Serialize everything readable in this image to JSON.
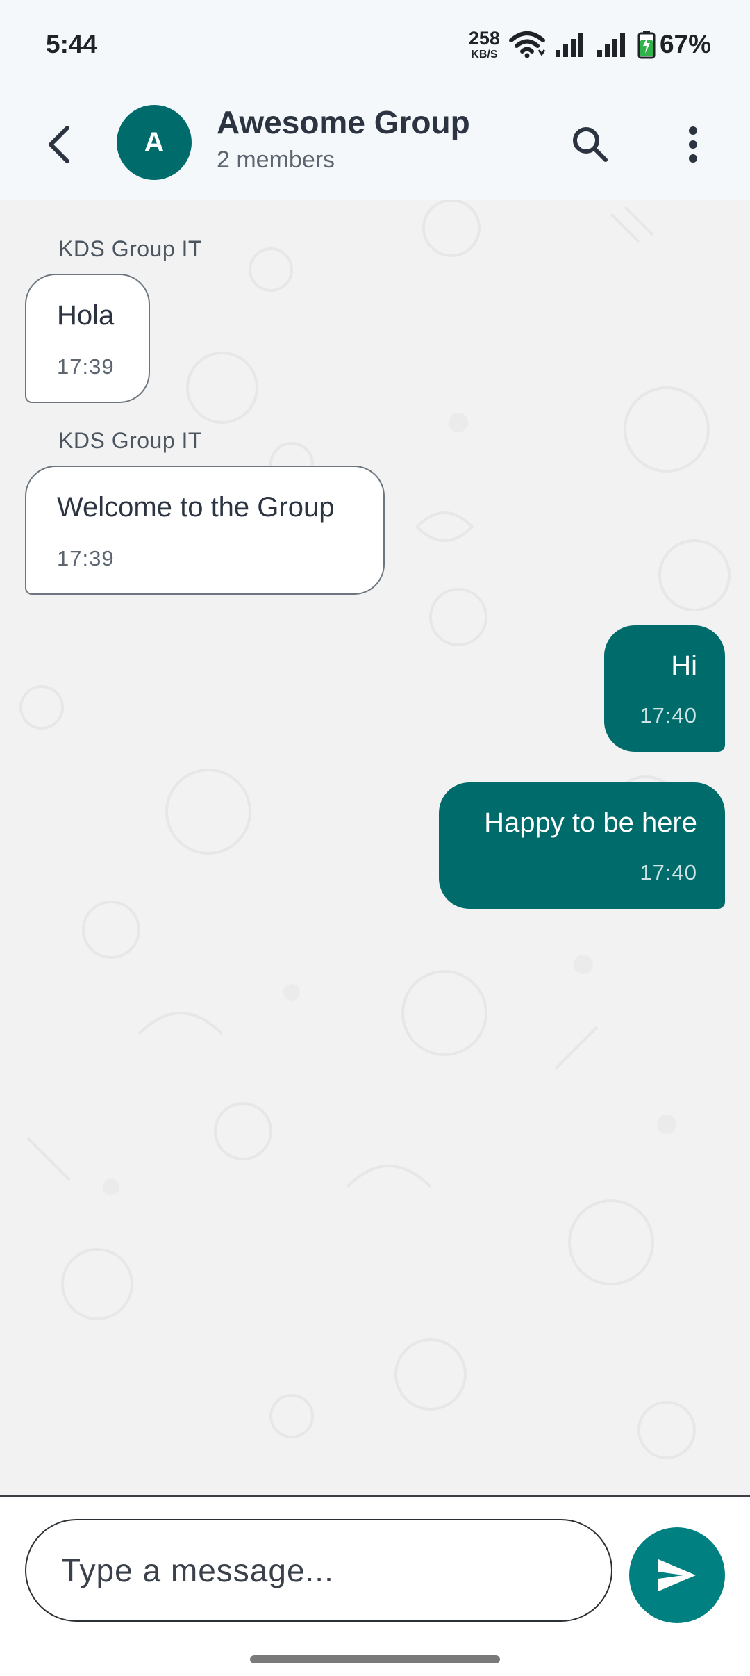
{
  "status_bar": {
    "time": "5:44",
    "net_speed_value": "258",
    "net_speed_unit": "KB/S",
    "battery_percent": "67%",
    "icons": [
      "wifi-icon",
      "signal-icon",
      "signal-icon",
      "battery-charging-icon"
    ]
  },
  "header": {
    "back_icon": "back-arrow-icon",
    "avatar_letter": "A",
    "group_name": "Awesome Group",
    "member_count": "2 members",
    "search_icon": "search-icon",
    "more_icon": "more-vertical-icon"
  },
  "messages": [
    {
      "direction": "incoming",
      "sender": "KDS Group IT",
      "text": "Hola",
      "time": "17:39"
    },
    {
      "direction": "incoming",
      "sender": "KDS Group IT",
      "text": "Welcome to the Group",
      "time": "17:39"
    },
    {
      "direction": "outgoing",
      "text": "Hi",
      "time": "17:40"
    },
    {
      "direction": "outgoing",
      "text": "Happy to be here",
      "time": "17:40"
    }
  ],
  "composer": {
    "placeholder": "Type a message...",
    "send_icon": "send-icon"
  },
  "colors": {
    "accent": "#006b6b",
    "send_button": "#008080",
    "header_bg": "#f4f8fa",
    "chat_bg": "#f2f2f2"
  }
}
